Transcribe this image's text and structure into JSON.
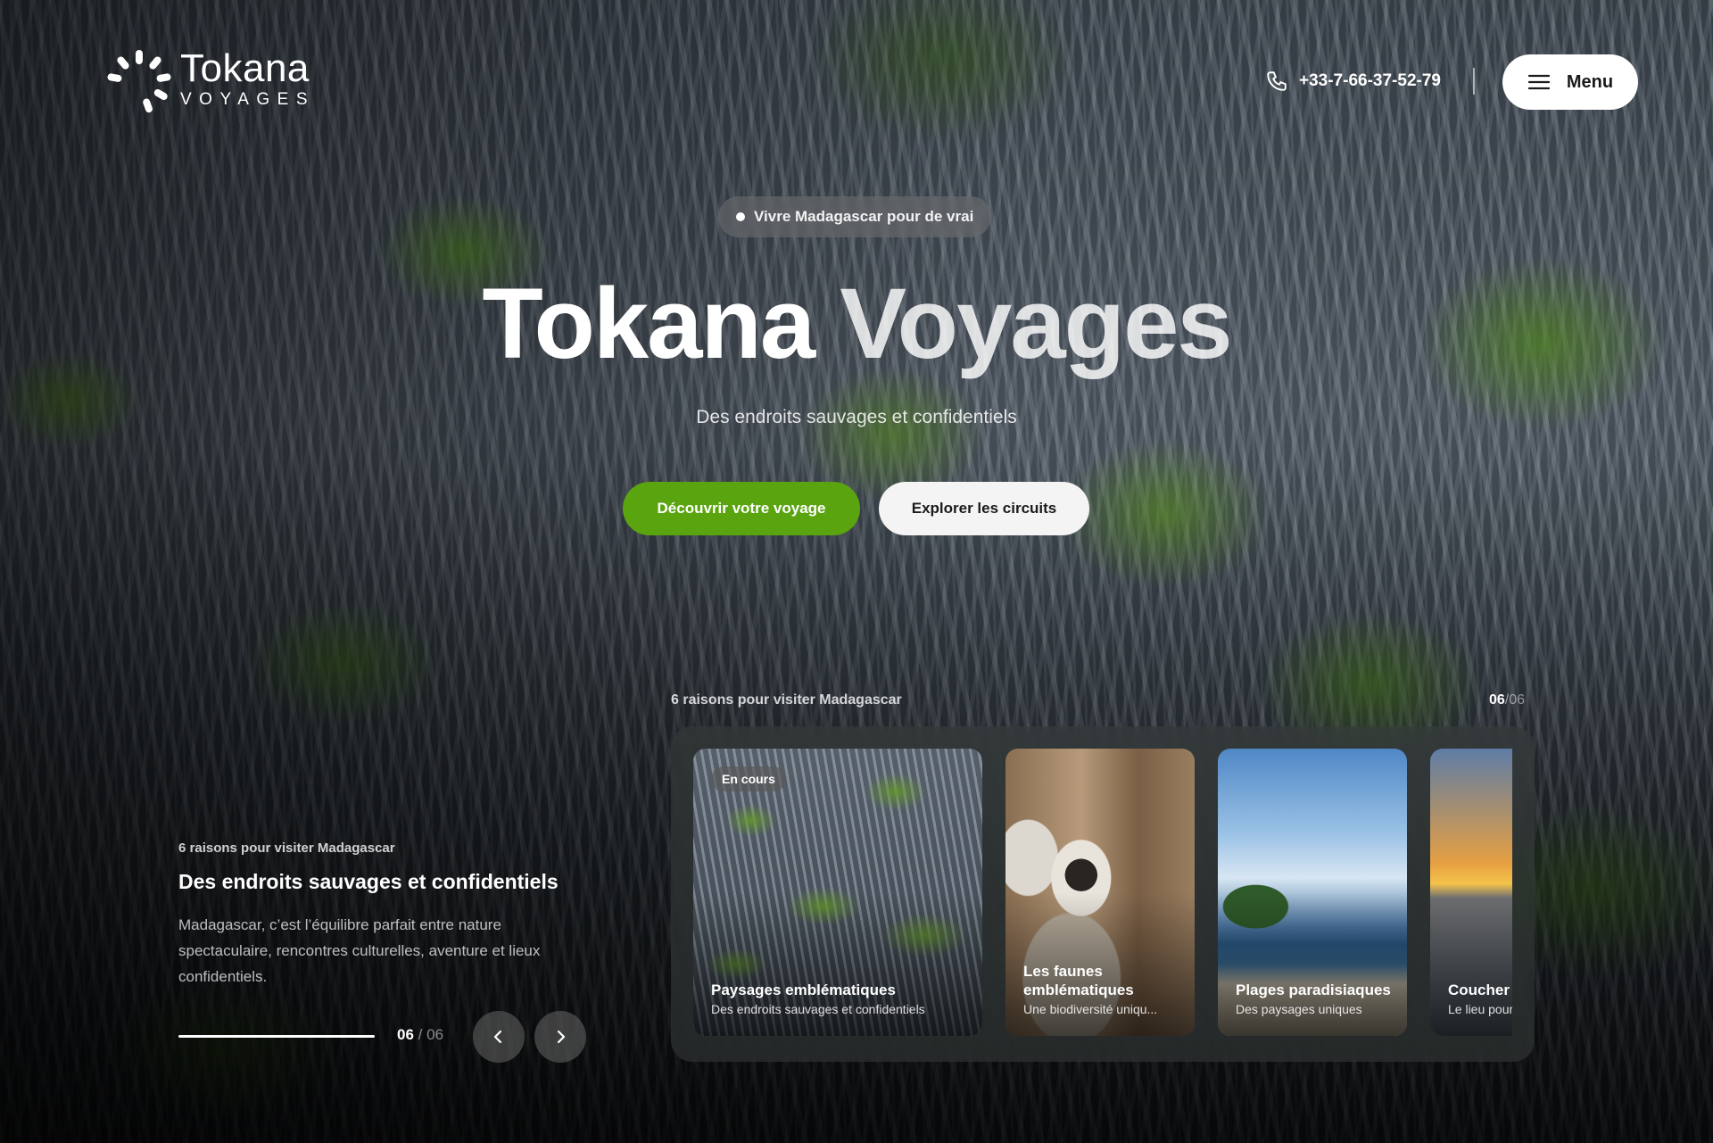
{
  "brand": {
    "name": "Tokana",
    "tagline": "VOYAGES"
  },
  "header": {
    "phone": "+33-7-66-37-52-79",
    "menu_label": "Menu"
  },
  "hero": {
    "badge": "Vivre Madagascar pour de vrai",
    "title_part1": "Tokana",
    "title_part2": "Voyages",
    "subtitle": "Des endroits sauvages et confidentiels",
    "primary_cta": "Découvrir votre voyage",
    "secondary_cta": "Explorer les circuits"
  },
  "feature": {
    "kicker": "6 raisons pour visiter Madagascar",
    "title": "Des endroits sauvages et confidentiels",
    "body": "Madagascar, c’est l’équilibre parfait entre nature spectaculaire, rencontres culturelles, aventure et lieux confidentiels.",
    "current": "06",
    "separator": "/",
    "total": "06",
    "progress": 1.0
  },
  "slider": {
    "kicker": "6 raisons pour visiter Madagascar",
    "current": "06",
    "separator": "/",
    "total": "06",
    "cards": [
      {
        "pill": "En cours",
        "title": "Paysages emblématiques",
        "subtitle": "Des endroits sauvages et confidentiels"
      },
      {
        "title": "Les faunes emblématiques",
        "subtitle": "Une biodiversité uniqu..."
      },
      {
        "title": "Plages paradisiaques",
        "subtitle": "Des paysages uniques"
      },
      {
        "title": "Coucher de soleil",
        "subtitle": "Le lieu pour..."
      }
    ]
  },
  "colors": {
    "accent": "#5aa50f",
    "button_light": "#f4f4f4"
  },
  "icons": {
    "logo": "sunburst-logo-icon",
    "phone": "phone-icon",
    "menu": "hamburger-icon",
    "prev": "chevron-left-icon",
    "next": "chevron-right-icon"
  }
}
